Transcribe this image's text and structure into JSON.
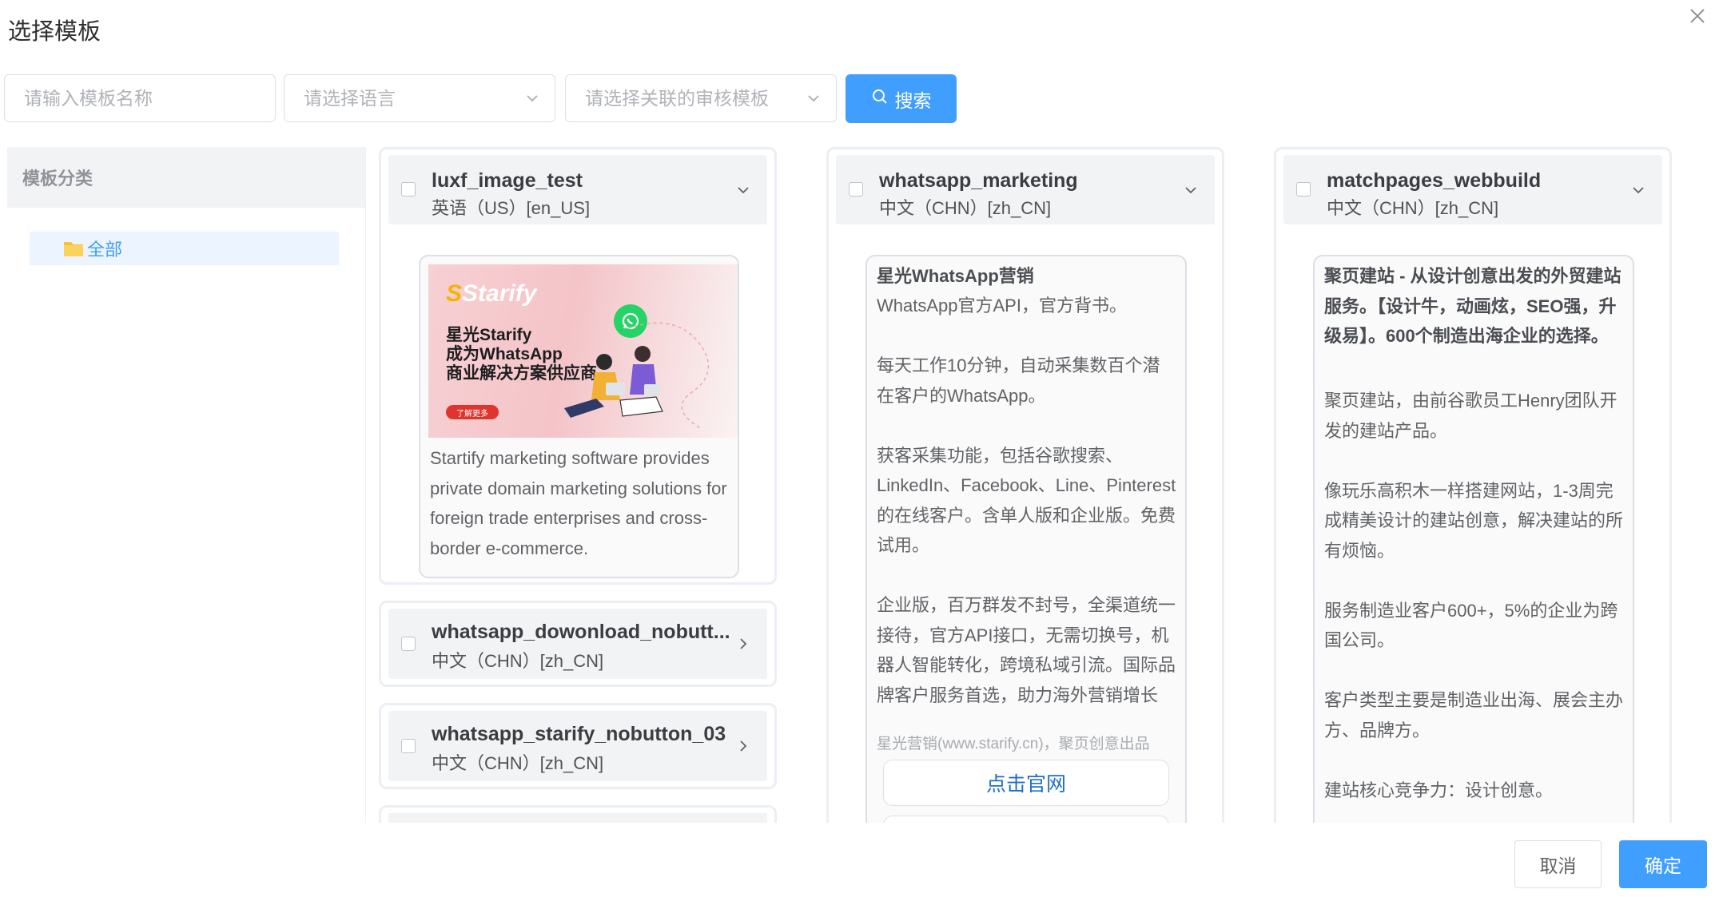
{
  "dialog": {
    "title": "选择模板",
    "close_icon": "close-icon"
  },
  "filters": {
    "name_placeholder": "请输入模板名称",
    "language_placeholder": "请选择语言",
    "review_placeholder": "请选择关联的审核模板",
    "search_label": "搜索"
  },
  "sidebar": {
    "header": "模板分类",
    "items": [
      {
        "label": "全部",
        "icon": "folder-icon"
      }
    ]
  },
  "templates": [
    {
      "name": "luxf_image_test",
      "lang": "英语（US）[en_US]",
      "expanded": true,
      "banner": {
        "brand": "Starify",
        "lines": [
          "星光Starify",
          "成为WhatsApp",
          "商业解决方案供应商"
        ],
        "cta": "了解更多"
      },
      "body": "Startify marketing software provides private domain marketing solutions for foreign trade enterprises and cross-border e-commerce."
    },
    {
      "name": "whatsapp_dowonload_nobutt...",
      "lang": "中文（CHN）[zh_CN]",
      "expanded": false
    },
    {
      "name": "whatsapp_starify_nobutton_03",
      "lang": "中文（CHN）[zh_CN]",
      "expanded": false
    },
    {
      "name": "whatsapp_marketing",
      "lang": "中文（CHN）[zh_CN]",
      "expanded": true,
      "preview_title": "星光WhatsApp营销",
      "body": "WhatsApp官方API，官方背书。\n\n每天工作10分钟，自动采集数百个潜在客户的WhatsApp。\n\n获客采集功能，包括谷歌搜索、LinkedIn、Facebook、Line、Pinterest的在线客户。含单人版和企业版。免费试用。\n\n企业版，百万群发不封号，全渠道统一接待，官方API接口，无需切换号，机器人智能转化，跨境私域引流。国际品牌客户服务首选，助力海外营销增长",
      "footer": "星光营销(www.starify.cn)，聚页创意出品",
      "button": "点击官网"
    },
    {
      "name": "matchpages_webbuild",
      "lang": "中文（CHN）[zh_CN]",
      "expanded": true,
      "preview_title": "聚页建站 - 从设计创意出发的外贸建站服务。【设计牛，动画炫，SEO强，升级易】。600个制造出海企业的选择。",
      "body": "聚页建站，由前谷歌员工Henry团队开发的建站产品。\n\n像玩乐高积木一样搭建网站，1-3周完成精美设计的建站创意，解决建站的所有烦恼。\n\n服务制造业客户600+，5%的企业为跨国公司。\n\n客户类型主要是制造业出海、展会主办方、品牌方。\n\n建站核心竞争力：设计创意。"
    }
  ],
  "footer": {
    "cancel": "取消",
    "confirm": "确定"
  }
}
